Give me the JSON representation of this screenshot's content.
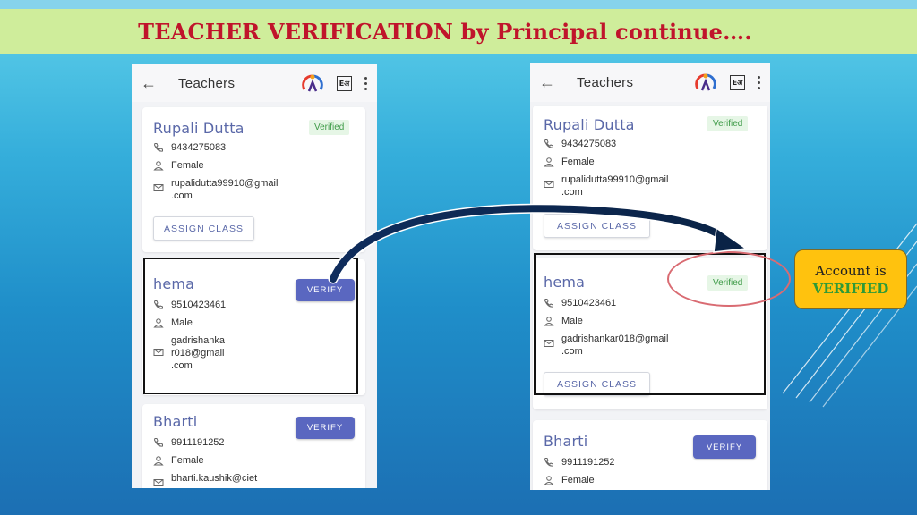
{
  "banner": {
    "title": "TEACHER VERIFICATION by Principal continue…."
  },
  "left_screen": {
    "appbar": {
      "title": "Teachers",
      "lang_label": "Eअ"
    },
    "teachers": [
      {
        "name": "Rupali Dutta",
        "phone": "9434275083",
        "gender": "Female",
        "email_l1": "rupalidutta99910@gmail",
        "email_l2": ".com",
        "status": "Verified",
        "action": "ASSIGN CLASS"
      },
      {
        "name": "hema",
        "phone": "9510423461",
        "gender": "Male",
        "email_l1": "gadrishanka",
        "email_l2": "r018@gmail",
        "email_l3": ".com",
        "action": "VERIFY"
      },
      {
        "name": "Bharti",
        "phone": "9911191252",
        "gender": "Female",
        "email_l1": "bharti.kaushik@ciet",
        "action": "VERIFY"
      }
    ]
  },
  "right_screen": {
    "appbar": {
      "title": "Teachers",
      "lang_label": "Eअ"
    },
    "teachers": [
      {
        "name": "Rupali Dutta",
        "phone": "9434275083",
        "gender": "Female",
        "email_l1": "rupalidutta99910@gmail",
        "email_l2": ".com",
        "status": "Verified",
        "action": "ASSIGN CLASS"
      },
      {
        "name": "hema",
        "phone": "9510423461",
        "gender": "Male",
        "email_l1": "gadrishankar018@gmail",
        "email_l2": ".com",
        "status": "Verified",
        "action": "ASSIGN CLASS"
      },
      {
        "name": "Bharti",
        "phone": "9911191252",
        "gender": "Female",
        "action": "VERIFY"
      }
    ]
  },
  "callout": {
    "line1": "Account is",
    "line2": "VERIFIED"
  },
  "colors": {
    "banner_bg": "#cfed9b",
    "banner_text": "#c0142b",
    "accent": "#5a67c0",
    "verified_green": "#3d9a47",
    "callout_bg": "#ffc20e"
  }
}
